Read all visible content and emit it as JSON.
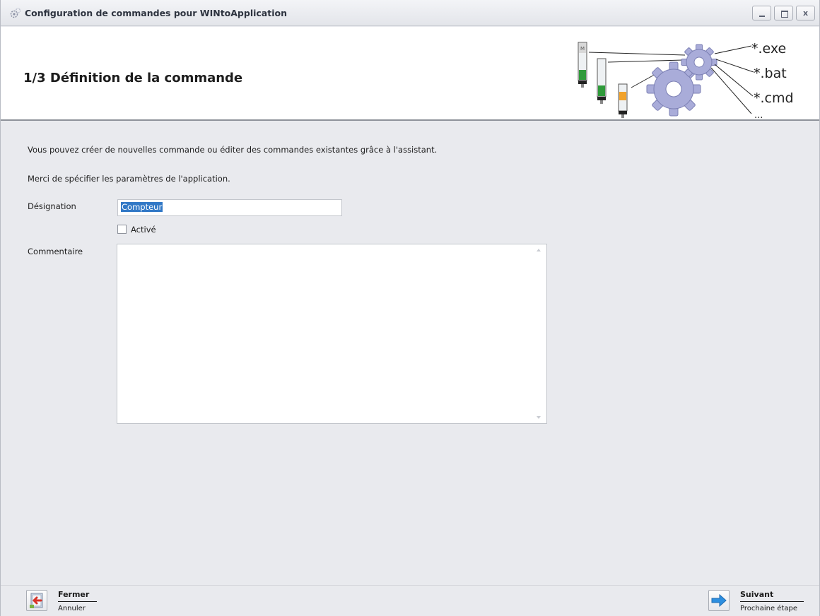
{
  "window": {
    "title": "Configuration de commandes pour WINtoApplication",
    "icon": "gear-icon",
    "controls": {
      "minimize_icon": "minimize-icon",
      "maximize_icon": "maximize-icon",
      "close_label": "x"
    }
  },
  "header": {
    "step_title": "1/3 Définition de la commande",
    "illustration": {
      "extensions": [
        "*.exe",
        "*.bat",
        "*.cmd",
        "..."
      ],
      "stack_light_top_label": "M",
      "colors": {
        "gear": "#a9acd9",
        "green": "#2f9a3a",
        "orange": "#f1a22b"
      }
    }
  },
  "content": {
    "intro": "Vous pouvez créer de nouvelles commande ou éditer des commandes existantes grâce à l'assistant.",
    "instruction": "Merci de spécifier les paramètres de l'application.",
    "designation": {
      "label": "Désignation",
      "value": "Compteur"
    },
    "active": {
      "label": "Activé",
      "checked": false
    },
    "comment": {
      "label": "Commentaire",
      "value": ""
    }
  },
  "footer": {
    "close": {
      "label": "Fermer",
      "sublabel": "Annuler",
      "icon": "close-door-icon"
    },
    "next": {
      "label": "Suivant",
      "sublabel": "Prochaine étape",
      "icon": "arrow-right-icon"
    }
  },
  "colors": {
    "background": "#e9eaee",
    "selection": "#3178c6",
    "header_bg": "#ffffff"
  }
}
